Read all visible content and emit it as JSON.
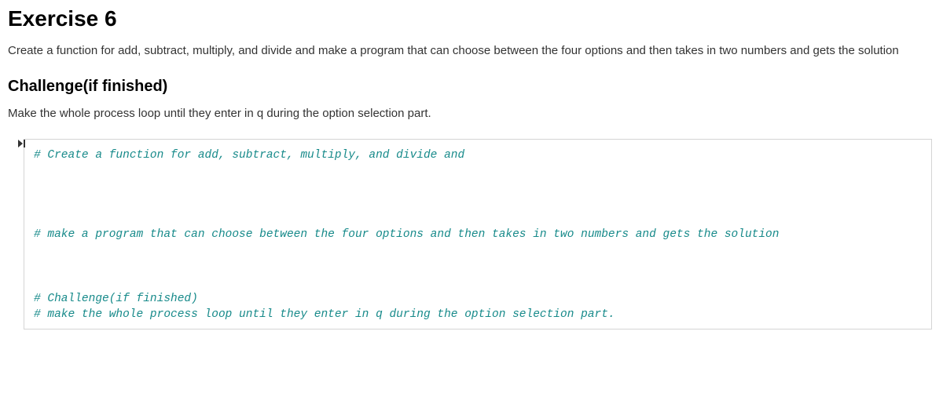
{
  "exercise": {
    "heading": "Exercise 6",
    "description": "Create a function for add, subtract, multiply, and divide and make a program that can choose between the four options and then takes in two numbers and gets the solution"
  },
  "challenge": {
    "heading": "Challenge(if finished)",
    "description": "Make the whole process loop until they enter in q during the option selection part."
  },
  "collapser_glyph": "⏵⎸",
  "code": {
    "lines": [
      {
        "type": "comment",
        "text": "# Create a function for add, subtract, multiply, and divide and"
      },
      {
        "type": "blank",
        "text": ""
      },
      {
        "type": "blank",
        "text": ""
      },
      {
        "type": "blank",
        "text": ""
      },
      {
        "type": "blank",
        "text": ""
      },
      {
        "type": "comment",
        "text": "# make a program that can choose between the four options and then takes in two numbers and gets the solution"
      },
      {
        "type": "blank",
        "text": ""
      },
      {
        "type": "blank",
        "text": ""
      },
      {
        "type": "blank",
        "text": ""
      },
      {
        "type": "comment",
        "text": "# Challenge(if finished)"
      },
      {
        "type": "comment",
        "text": "# make the whole process loop until they enter in q during the option selection part."
      }
    ]
  }
}
